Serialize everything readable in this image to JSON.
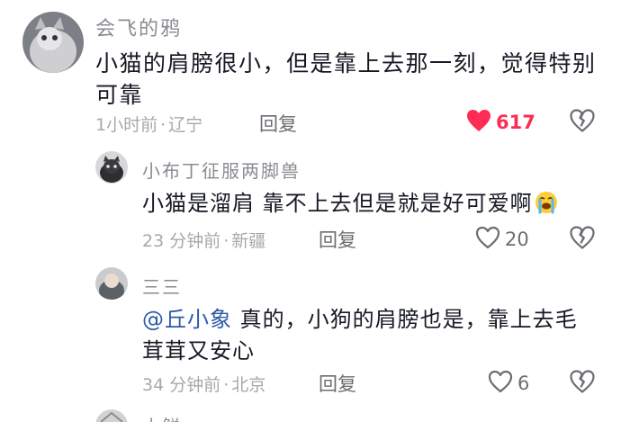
{
  "comments": [
    {
      "username": "会飞的鸦",
      "text": "小猫的肩膀很小，但是靠上去那一刻，觉得特别可靠",
      "time": "1小时前",
      "location": "辽宁",
      "reply_label": "回复",
      "like_count": "617",
      "liked": true
    }
  ],
  "replies": [
    {
      "username": "小布丁征服两脚兽",
      "text": "小猫是溜肩 靠不上去但是就是好可爱啊",
      "emoji": "loudly-crying-face",
      "time": "23 分钟前",
      "location": "新疆",
      "reply_label": "回复",
      "like_count": "20",
      "liked": false
    },
    {
      "username": "三三",
      "mention": "@丘小象",
      "text": " 真的，小狗的肩膀也是，靠上去毛茸茸又安心",
      "time": "34 分钟前",
      "location": "北京",
      "reply_label": "回复",
      "like_count": "6",
      "liked": false
    }
  ],
  "partial_next": {
    "username": "小鲜"
  },
  "colors": {
    "like_active": "#fe2c55",
    "mention": "#2d5aa8",
    "meta": "#a7a8ad"
  }
}
